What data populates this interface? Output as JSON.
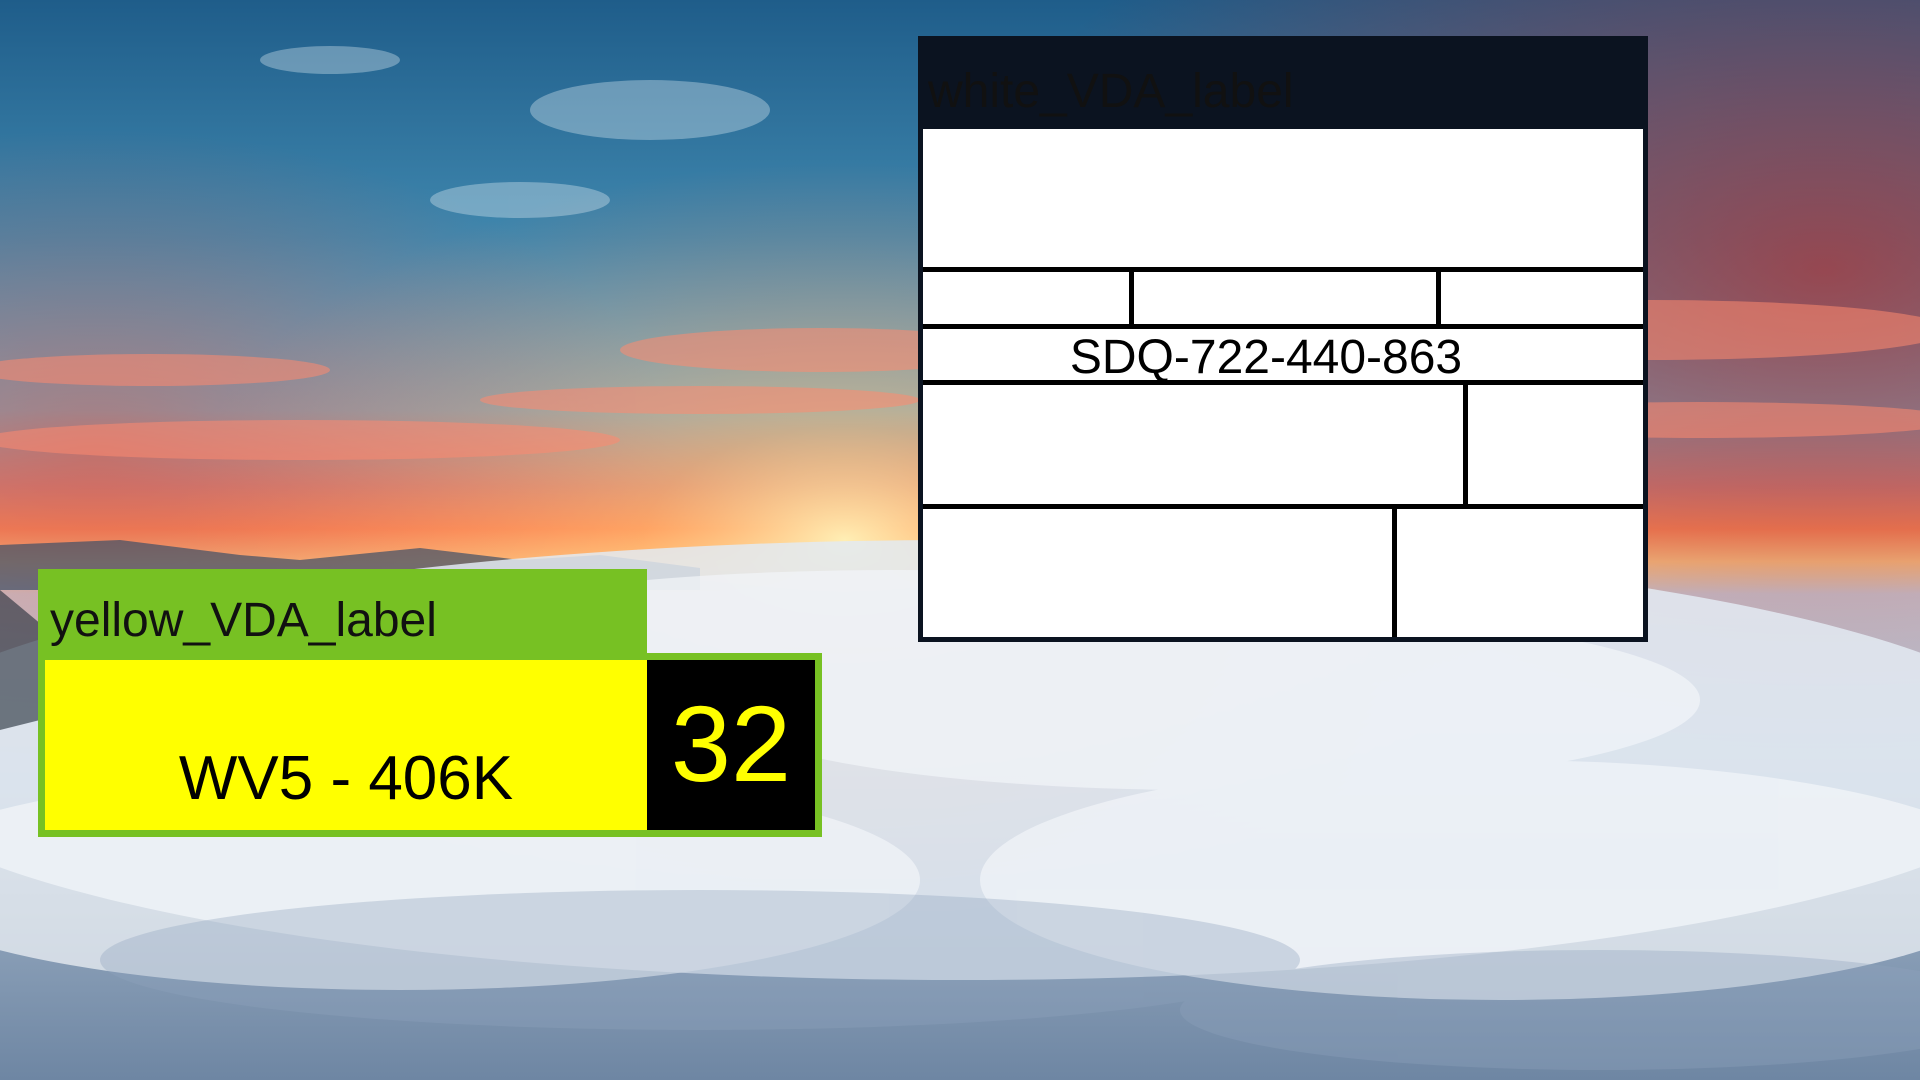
{
  "yellow_label": {
    "title": "yellow_VDA_label",
    "plate_text": "WV5 - 406K",
    "number": "32",
    "colors": {
      "header": "#77c123",
      "panel": "#ffff00",
      "number_box": "#000000",
      "number_text": "#ffff00"
    }
  },
  "white_label": {
    "title": "white_VDA_label",
    "serial": "SDQ-722-440-863",
    "colors": {
      "header": "#0b1320",
      "panel": "#ffffff",
      "lines": "#000000"
    }
  },
  "wallpaper": {
    "description_colors": {
      "sky_top": "#2d6f9a",
      "sky_mid": "#5aa2c2",
      "sunset": "#ff9a56",
      "clouds": "#dfe6ef"
    }
  }
}
